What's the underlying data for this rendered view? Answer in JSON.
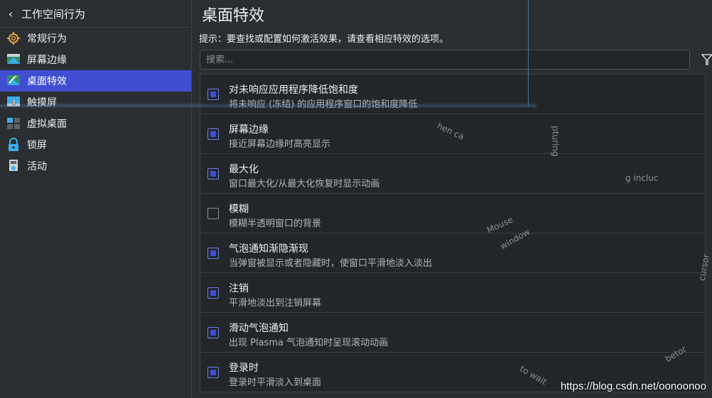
{
  "sidebar": {
    "back_label": "工作空间行为",
    "items": [
      {
        "label": "常规行为",
        "icon": "gear-icon"
      },
      {
        "label": "屏幕边缘",
        "icon": "screen-edge-icon"
      },
      {
        "label": "桌面特效",
        "icon": "desktop-effects-icon",
        "active": true
      },
      {
        "label": "触摸屏",
        "icon": "touchscreen-icon"
      },
      {
        "label": "虚拟桌面",
        "icon": "virtual-desktops-icon"
      },
      {
        "label": "锁屏",
        "icon": "lock-icon"
      },
      {
        "label": "活动",
        "icon": "activities-icon"
      }
    ]
  },
  "main": {
    "title": "桌面特效",
    "hint": "提示：要查找或配置如何激活效果，请查看相应特效的选项。",
    "search_placeholder": "搜索...",
    "effects": [
      {
        "name": "对未响应应用程序降低饱和度",
        "desc": "将未响应 (冻结) 的应用程序窗口的饱和度降低",
        "checked": true
      },
      {
        "name": "屏幕边缘",
        "desc": "接近屏幕边缘时高亮显示",
        "checked": true
      },
      {
        "name": "最大化",
        "desc": "窗口最大化/从最大化恢复时显示动画",
        "checked": true
      },
      {
        "name": "模糊",
        "desc": "模糊半透明窗口的背景",
        "checked": false
      },
      {
        "name": "气泡通知渐隐渐现",
        "desc": "当弹窗被显示或者隐藏时，使窗口平滑地淡入淡出",
        "checked": true
      },
      {
        "name": "注销",
        "desc": "平滑地淡出到注销屏幕",
        "checked": true
      },
      {
        "name": "滑动气泡通知",
        "desc": "出现 Plasma 气泡通知时呈现滚动动画",
        "checked": true
      },
      {
        "name": "登录时",
        "desc": "登录时平滑淡入到桌面",
        "checked": true
      }
    ]
  },
  "overlay": {
    "watermark": "https://blog.csdn.net/oonoonoo",
    "fragments": [
      "hen ca",
      "pturing",
      "g incluc",
      "Mouse",
      "window",
      "cursor",
      "to wait",
      "betor"
    ]
  },
  "colors": {
    "accent": "#3f4ed1",
    "background": "#2a2e32",
    "list_background": "#232629"
  }
}
